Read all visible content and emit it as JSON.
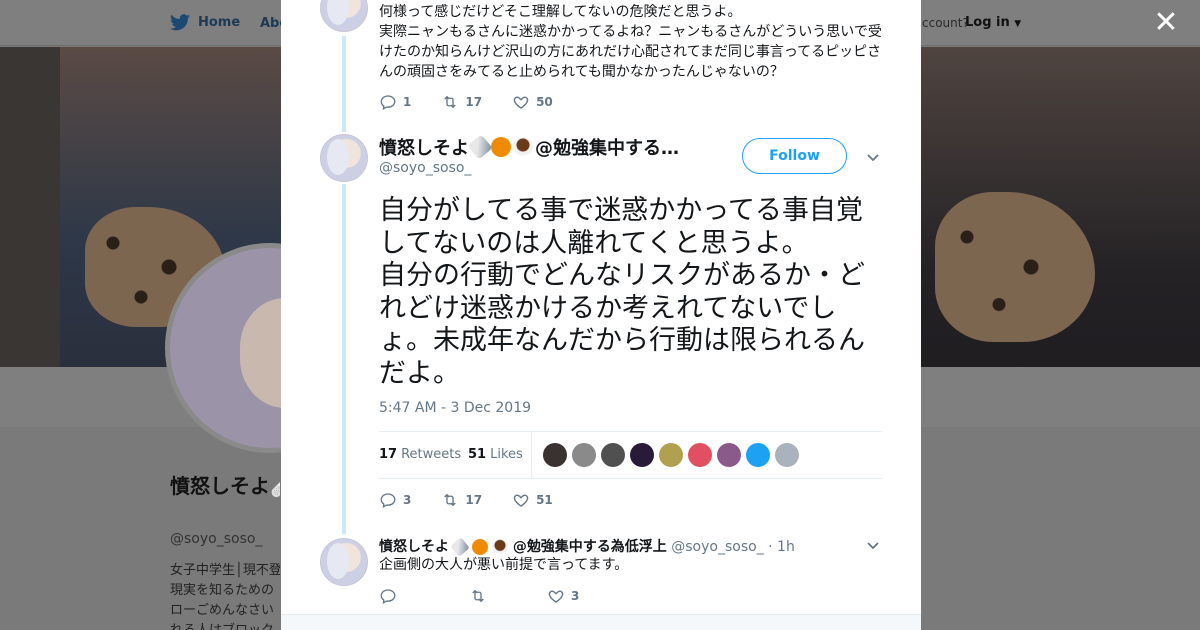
{
  "nav": {
    "home_label": "Home",
    "about_label": "Abo",
    "account_text": "ccount?",
    "login_label": "Log in"
  },
  "profile": {
    "name": "憤怒しそよ🩹🍊☕@勉強集中する為",
    "handle": "@soyo_soso_",
    "bio_lines": [
      "女子中学生│現不登",
      "現実を知るための",
      "ローごめんなさい",
      "れる人はブロック"
    ]
  },
  "modal": {
    "close_label": "✕",
    "prev_tweet": {
      "text": "何様って感じだけどそこ理解してないの危険だと思うよ。\n実際ニャンもるさんに迷惑かかってるよね？ニャンもるさんがどういう思いで受けたのか知らんけど沢山の方にあれだけ心配されてまだ同じ事言ってるピッピさんの頑固さをみてると止められても聞かなかったんじゃないの？",
      "replies": "1",
      "retweets": "17",
      "likes": "50"
    },
    "main_tweet": {
      "display_name": "憤怒しそよ",
      "display_name_suffix": "@勉強集中する…",
      "handle": "@soyo_soso_",
      "follow_label": "Follow",
      "text": "自分がしてる事で迷惑かかってる事自覚してないのは人離れてくと思うよ。\n自分の行動でどんなリスクがあるか・どれどけ迷惑かけるか考えれてないでしょ。未成年なんだから行動は限られるんだよ。",
      "timestamp": "5:47 AM - 3 Dec 2019",
      "retweet_count": "17",
      "retweet_label": "Retweets",
      "like_count": "51",
      "like_label": "Likes",
      "replies": "3",
      "retweets": "17",
      "likes": "51"
    },
    "reply_tweet": {
      "display_name": "憤怒しそよ",
      "display_name_suffix": "@勉強集中する為低浮上",
      "handle": "@soyo_soso_",
      "time": "· 1h",
      "text": "企画側の大人が悪い前提で言ってます。",
      "replies": "",
      "retweets": "",
      "likes": "3"
    }
  },
  "colors": {
    "accent": "#1da1f2",
    "thread_line": "#cce8fb",
    "muted_text": "#657786",
    "overlay": "#7a7a7a"
  },
  "liker_colors": [
    "#3a3230",
    "#8a8a8a",
    "#505050",
    "#2a1a3a",
    "#b0a050",
    "#e05060",
    "#8a5a8a",
    "#1da1f2",
    "#aab2bd"
  ]
}
